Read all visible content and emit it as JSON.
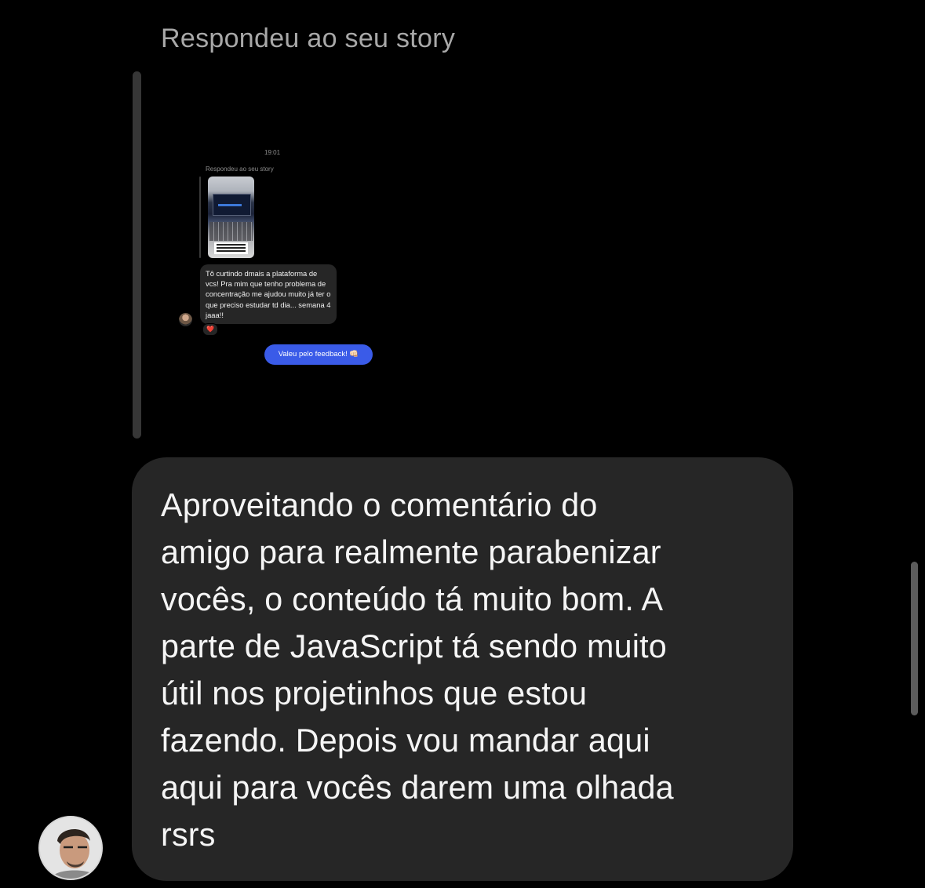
{
  "story_reply": {
    "label": "Respondeu ao seu story",
    "preview": {
      "time": "19:01",
      "reply_label": "Respondeu ao seu story",
      "incoming_message": "Tô curtindo dmais a plataforma de vcs! Pra mim que tenho problema de concentração me ajudou muito já ter o que preciso estudar td dia... semana 4 jaaa!!",
      "reaction_icon": "heart-reaction-icon",
      "reaction": "❤️",
      "sent_message": "Valeu pelo feedback! 👊🏻"
    }
  },
  "message": {
    "lines": [
      "Aproveitando o comentário do",
      "amigo para realmente parabenizar",
      "vocês, o conteúdo tá muito bom. A",
      "parte de JavaScript tá sendo muito",
      "útil nos projetinhos que estou",
      "fazendo. Depois vou mandar aqui",
      "aqui para vocês darem uma olhada",
      "rsrs"
    ]
  },
  "colors": {
    "background": "#000000",
    "bubble": "#262626",
    "sent_bubble": "#3a5be8",
    "muted_text": "#a8a8a8"
  }
}
